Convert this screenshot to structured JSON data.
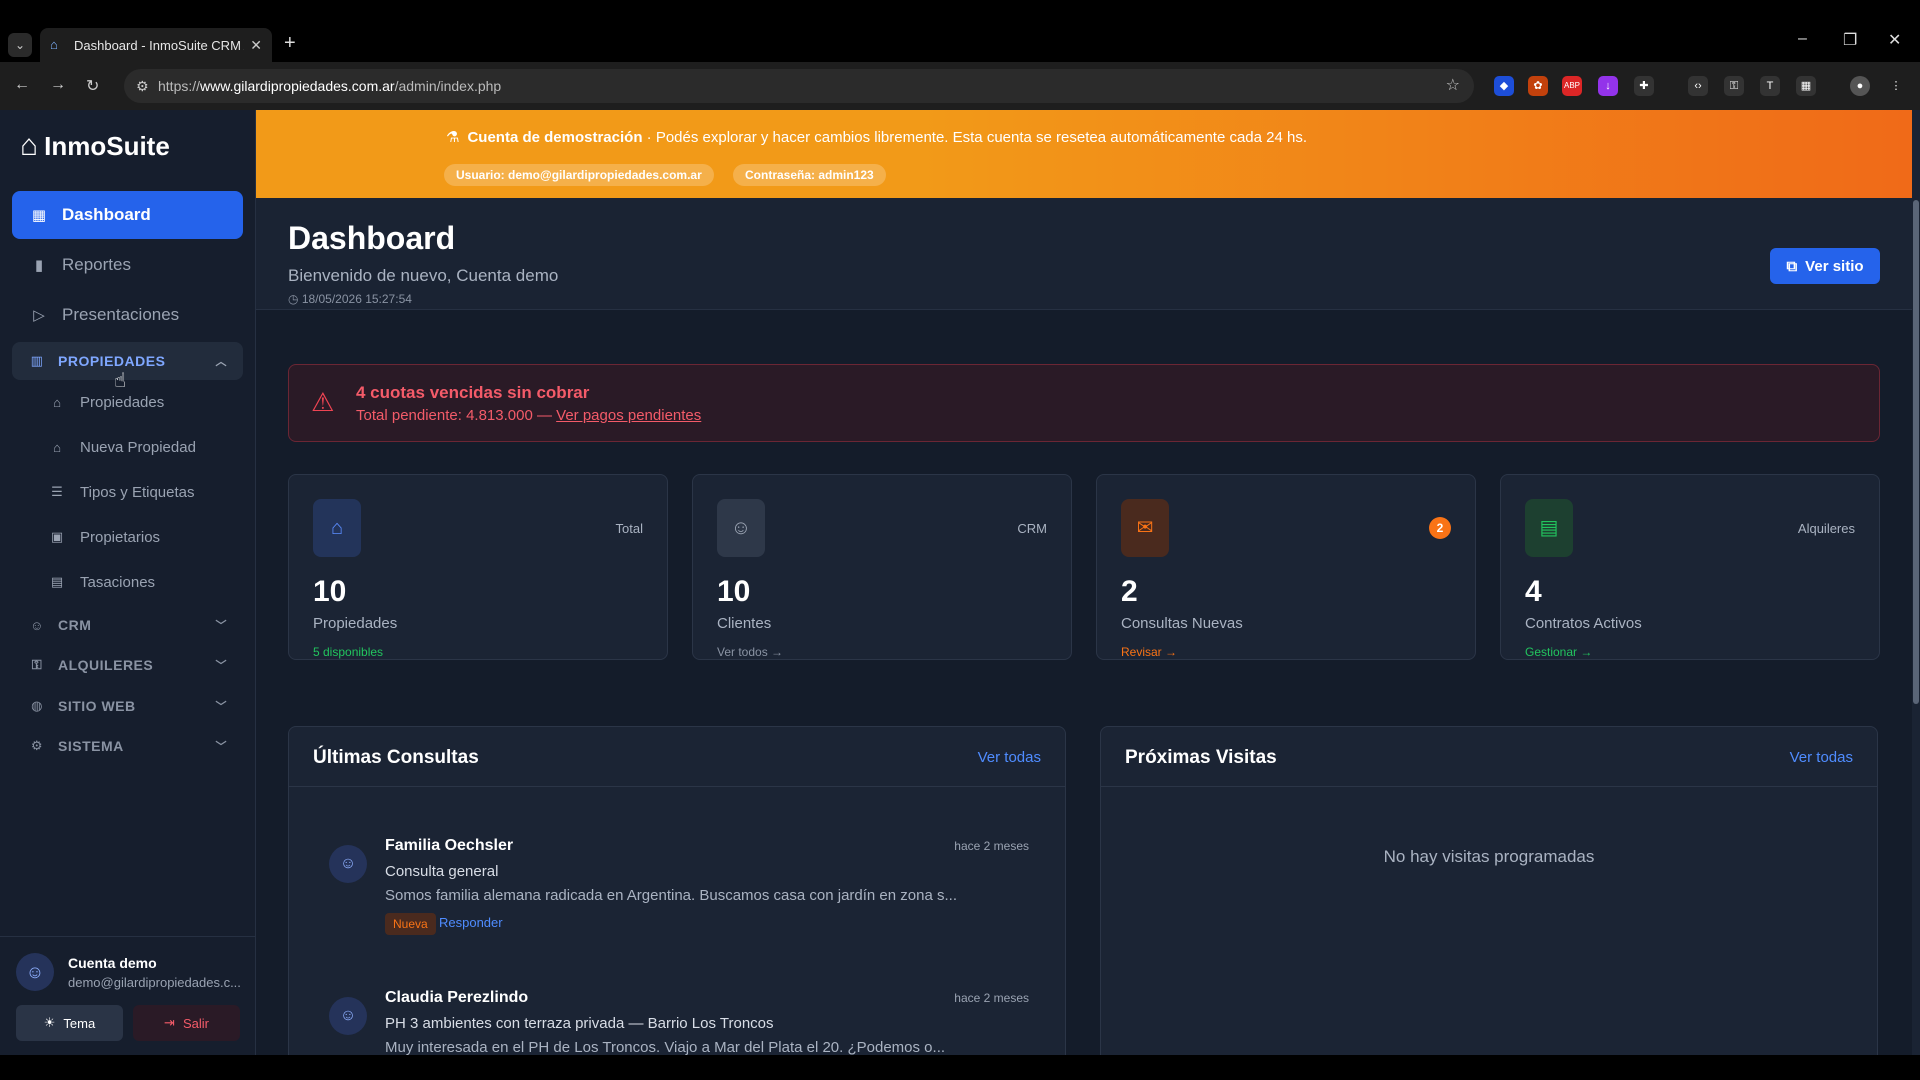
{
  "browser": {
    "tab_title": "Dashboard - InmoSuite CRM A",
    "url_prefix": "https://",
    "url_host": "www.gilardipropiedades.com.ar",
    "url_path": "/admin/index.php"
  },
  "sidebar": {
    "logo": "InmoSuite",
    "items": [
      {
        "label": "Dashboard"
      },
      {
        "label": "Reportes"
      },
      {
        "label": "Presentaciones"
      }
    ],
    "groups": [
      {
        "label": "PROPIEDADES"
      },
      {
        "label": "CRM"
      },
      {
        "label": "ALQUILERES"
      },
      {
        "label": "SITIO WEB"
      },
      {
        "label": "SISTEMA"
      }
    ],
    "subitems": [
      {
        "label": "Propiedades"
      },
      {
        "label": "Nueva Propiedad"
      },
      {
        "label": "Tipos y Etiquetas"
      },
      {
        "label": "Propietarios"
      },
      {
        "label": "Tasaciones"
      }
    ],
    "user_name": "Cuenta demo",
    "user_email": "demo@gilardipropiedades.c...",
    "theme_button": "Tema",
    "logout_button": "Salir"
  },
  "banner": {
    "title": "Cuenta de demostración",
    "text": " · Podés explorar y hacer cambios libremente. Esta cuenta se resetea automáticamente cada 24 hs.",
    "user_pill": "Usuario: demo@gilardipropiedades.com.ar",
    "pass_pill": "Contraseña: admin123"
  },
  "header": {
    "title": "Dashboard",
    "subtitle": "Bienvenido de nuevo, Cuenta demo",
    "timestamp": "18/05/2026 15:27:54",
    "view_site": "Ver sitio"
  },
  "alert": {
    "title": "4 cuotas vencidas sin cobrar",
    "text": "Total pendiente: 4.813.000 — ",
    "link": "Ver pagos pendientes"
  },
  "stats": [
    {
      "tag": "Total",
      "number": "10",
      "label": "Propiedades",
      "link": "5 disponibles",
      "icon": "home-icon"
    },
    {
      "tag": "CRM",
      "number": "10",
      "label": "Clientes",
      "link": "Ver todos →",
      "icon": "users-icon"
    },
    {
      "badge": "2",
      "number": "2",
      "label": "Consultas Nuevas",
      "link": "Revisar →",
      "icon": "mail-icon"
    },
    {
      "tag": "Alquileres",
      "number": "4",
      "label": "Contratos Activos",
      "link": "Gestionar →",
      "icon": "document-icon"
    }
  ],
  "consultas": {
    "title": "Últimas Consultas",
    "link": "Ver todas",
    "items": [
      {
        "name": "Familia Oechsler",
        "time": "hace 2 meses",
        "subject": "Consulta general",
        "body": "Somos familia alemana radicada en Argentina. Buscamos casa con jardín en zona s...",
        "badge": "Nueva",
        "action": "Responder"
      },
      {
        "name": "Claudia Perezlindo",
        "time": "hace 2 meses",
        "subject": "PH 3 ambientes con terraza privada — Barrio Los Troncos",
        "body": "Muy interesada en el PH de Los Troncos. Viajo a Mar del Plata el 20. ¿Podemos o..."
      }
    ]
  },
  "visitas": {
    "title": "Próximas Visitas",
    "link": "Ver todas",
    "empty": "No hay visitas programadas"
  },
  "colors": {
    "accent": "#2563eb",
    "banner": "#f29a18",
    "danger": "#f45b69"
  }
}
